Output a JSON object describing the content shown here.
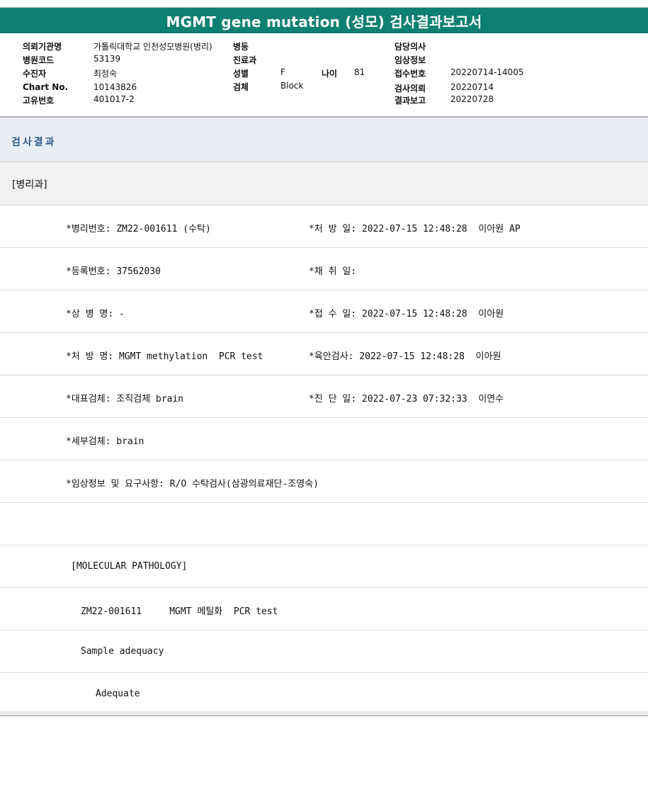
{
  "title": "MGMT gene mutation (성모) 검사결과보고서",
  "info": {
    "institution_label": "의뢰기관명",
    "institution": "가톨릭대학교 인천성모병원(병리)",
    "hospital_code_label": "병원코드",
    "hospital_code": "53139",
    "patient_label": "수진자",
    "patient": "최정숙",
    "chart_label": "Chart No.",
    "chart_no": "10143826",
    "unique_label": "고유번호",
    "unique_no": "401017-2",
    "ward_label": "병동",
    "ward": "",
    "dept_label": "진료과",
    "dept": "",
    "sex_label": "성별",
    "sex": "F",
    "age_label": "나이",
    "age": "81",
    "specimen_label": "검체",
    "specimen": "Block",
    "doctor_label": "담당의사",
    "doctor": "",
    "clinical_label": "임상정보",
    "clinical": "",
    "receipt_label": "접수번호",
    "receipt_no": "20220714-14005",
    "request_label": "검사의뢰",
    "request_date": "20220714",
    "report_label": "결과보고",
    "report_date": "20220728"
  },
  "section_title": "검사결과",
  "department": "[병리과]",
  "rows": [
    {
      "left": "*병리번호: ZM22-001611 (수탁)",
      "right": "*처 방 일: 2022-07-15 12:48:28  이아원 AP"
    },
    {
      "left": "*등록번호: 37562030",
      "right": "*채 취 일:"
    },
    {
      "left": "*상 병 명: -",
      "right": "*접 수 일: 2022-07-15 12:48:28  이아원"
    },
    {
      "left": "*처 방 명: MGMT methylation  PCR test",
      "right": "*육안검사: 2022-07-15 12:48:28  이아원"
    },
    {
      "left": "*대표검체: 조직검체 brain",
      "right": "*진 단 일: 2022-07-23 07:32:33  이연수"
    },
    {
      "left": "*세부검체: brain",
      "right": ""
    },
    {
      "left": "*임상정보 및 요구사항: R/O 수탁검사(삼광의료재단-조영숙)",
      "right": ""
    }
  ],
  "report": {
    "header": "[MOLECULAR PATHOLOGY]",
    "test_line": "ZM22-001611     MGMT 메틸화  PCR test",
    "adequacy_label": "Sample adequacy",
    "adequacy_value": "Adequate"
  }
}
